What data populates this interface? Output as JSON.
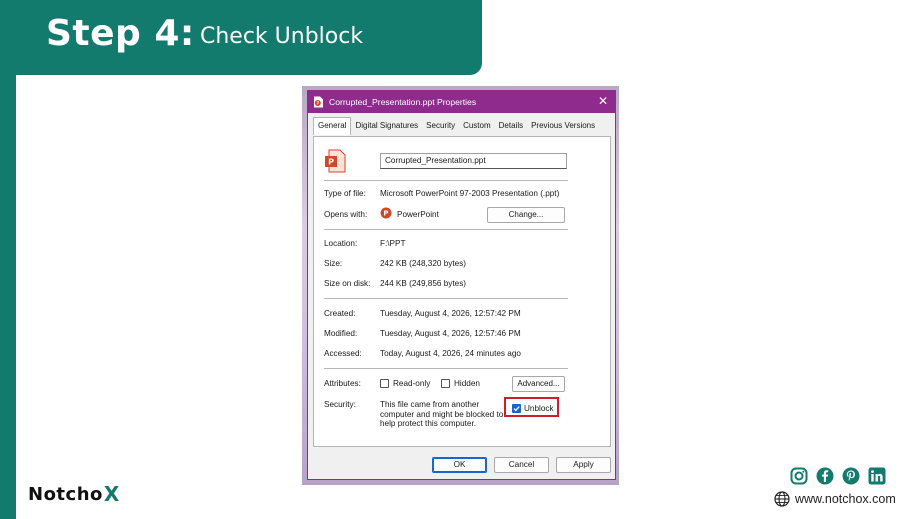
{
  "slide": {
    "step_title": "Step 4:",
    "step_subtitle": "Check Unblock",
    "logo_main": "Notch",
    "logo_o": "o",
    "logo_x": "X",
    "website": "www.notchox.com",
    "social_icons": [
      "instagram-icon",
      "facebook-icon",
      "pinterest-icon",
      "linkedin-icon"
    ],
    "colors": {
      "brand": "#137a6e",
      "dialog_accent": "#8f2b8c",
      "highlight": "#cf1d2b",
      "checkbox": "#1a66c8"
    }
  },
  "dialog": {
    "title": "Corrupted_Presentation.ppt Properties",
    "close_glyph": "✕",
    "tabs": [
      {
        "label": "General",
        "active": true
      },
      {
        "label": "Digital Signatures",
        "active": false
      },
      {
        "label": "Security",
        "active": false
      },
      {
        "label": "Custom",
        "active": false
      },
      {
        "label": "Details",
        "active": false
      },
      {
        "label": "Previous Versions",
        "active": false
      }
    ],
    "filename": "Corrupted_Presentation.ppt",
    "type_label": "Type of file:",
    "type_value": "Microsoft PowerPoint 97-2003 Presentation (.ppt)",
    "opens_label": "Opens with:",
    "opens_value": "PowerPoint",
    "change_button": "Change...",
    "location_label": "Location:",
    "location_value": "F:\\PPT",
    "size_label": "Size:",
    "size_value": "242 KB (248,320 bytes)",
    "size_disk_label": "Size on disk:",
    "size_disk_value": "244 KB (249,856 bytes)",
    "created_label": "Created:",
    "created_value": "Tuesday, August 4, 2026, 12:57:42 PM",
    "modified_label": "Modified:",
    "modified_value": "Tuesday, August 4, 2026, 12:57:46 PM",
    "accessed_label": "Accessed:",
    "accessed_value": "Today, August 4, 2026, 24 minutes ago",
    "attributes_label": "Attributes:",
    "readonly_label": "Read-only",
    "hidden_label": "Hidden",
    "advanced_button": "Advanced...",
    "security_label": "Security:",
    "security_text_1": "This file came from another",
    "security_text_2": "computer and might be blocked to",
    "security_text_3": "help protect this computer.",
    "unblock_label": "Unblock",
    "ok_button": "OK",
    "cancel_button": "Cancel",
    "apply_button": "Apply"
  }
}
